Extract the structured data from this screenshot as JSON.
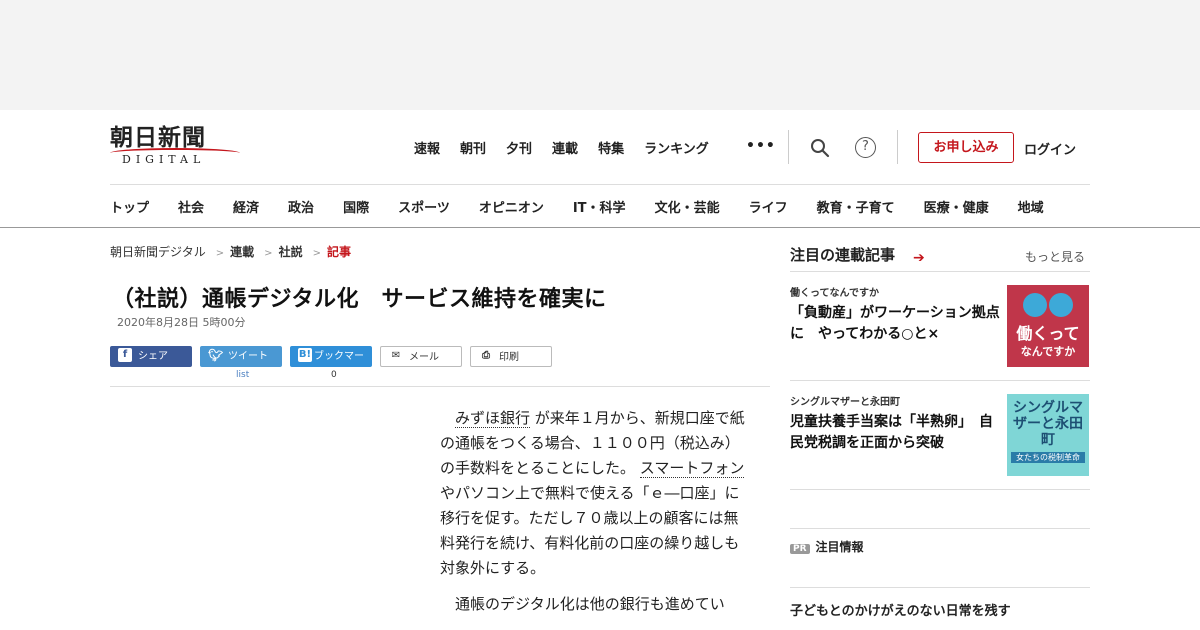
{
  "header": {
    "logo_jp": "朝日新聞",
    "logo_en": "DIGITAL",
    "top_nav": [
      "速報",
      "朝刊",
      "夕刊",
      "連載",
      "特集",
      "ランキング"
    ],
    "more_label": "•••",
    "help_label": "?",
    "apply_label": "お申し込み",
    "login_label": "ログイン"
  },
  "categories": [
    "トップ",
    "社会",
    "経済",
    "政治",
    "国際",
    "スポーツ",
    "オピニオン",
    "IT・科学",
    "文化・芸能",
    "ライフ",
    "教育・子育て",
    "医療・健康",
    "地域"
  ],
  "breadcrumb": [
    "朝日新聞デジタル",
    "連載",
    "社説",
    "記事"
  ],
  "article": {
    "title": "（社説）通帳デジタル化　サービス維持を確実に",
    "date": "2020年8月28日 5時00分",
    "p1_link1": "みずほ銀行",
    "p1_a": "が来年１月から、新規口座で紙の通帳をつくる場合、１１００円（税込み）の手数料をとることにした。",
    "p1_link2": "スマートフォン",
    "p1_b": "やパソコン上で無料で使える「ｅ―口座」に移行を促す。ただし７０歳以上の顧客には無料発行を続け、有料化前の口座の繰り越しも対象外にする。",
    "p2": "通帳のデジタル化は他の銀行も進めてい"
  },
  "share": {
    "facebook": "シェア",
    "twitter": "ツイート",
    "twitter_count": "list",
    "hatena": "ブックマーク",
    "hatena_count": "0",
    "mail": "メール",
    "print": "印刷"
  },
  "sidebar": {
    "heading": "注目の連載記事",
    "more": "もっと見る",
    "items": [
      {
        "series": "働くってなんですか",
        "title": "「負動産」がワーケーション拠点に　やってわかる○と×",
        "thumb_text": "働くって",
        "thumb_sub": "なんですか"
      },
      {
        "series": "シングルマザーと永田町",
        "title": "児童扶養手当案は「半熟卵」　自民党税調を正面から突破",
        "thumb_text": "シングルマザーと永田町",
        "thumb_sub": "女たちの税制革命"
      }
    ],
    "pr_badge": "PR",
    "pr_label": "注目情報",
    "promo_title": "子どもとのかけがえのない日常を残す"
  }
}
